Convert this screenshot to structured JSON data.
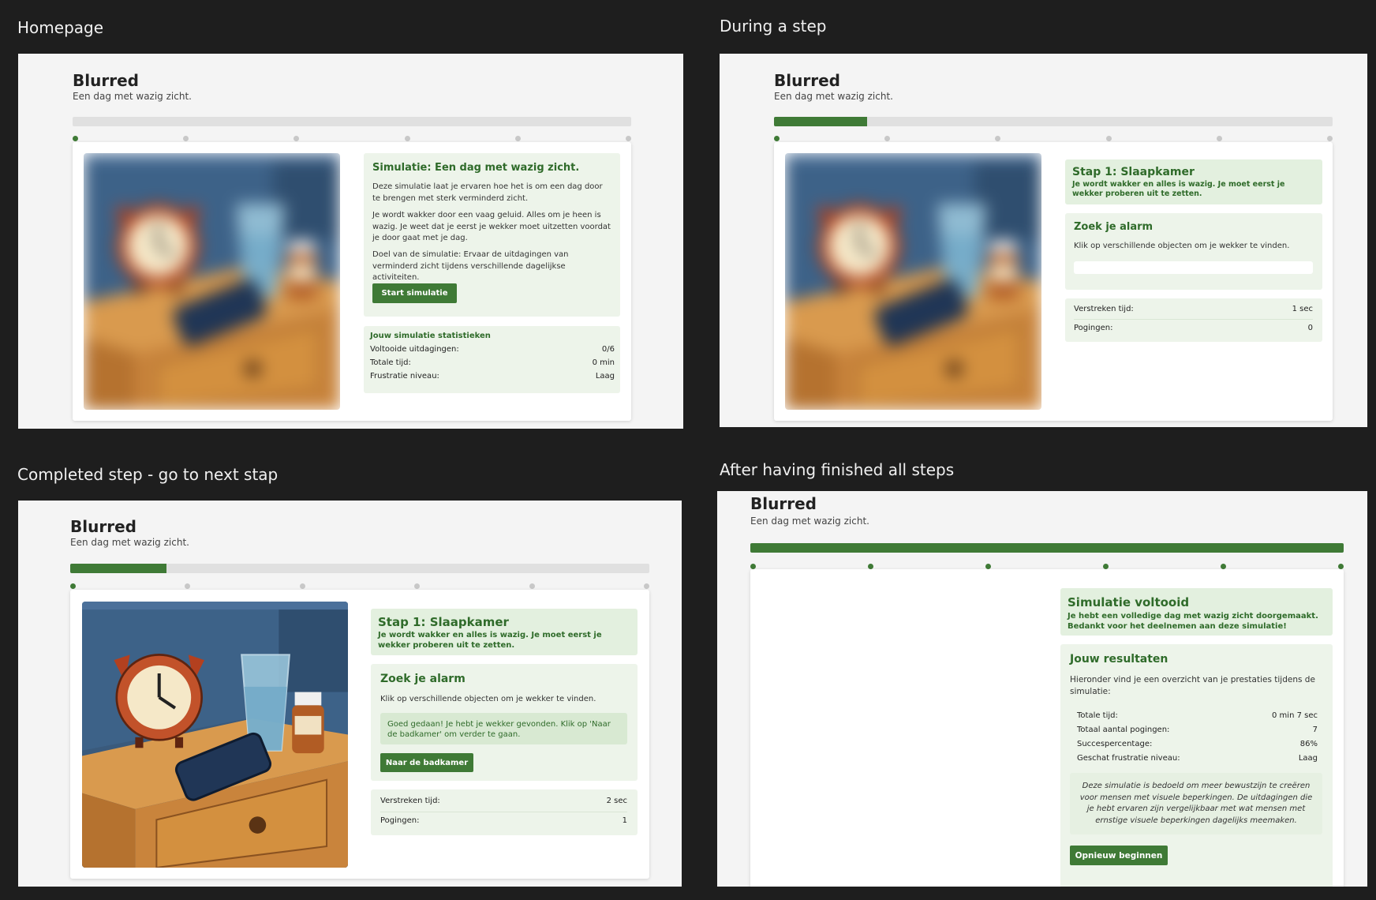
{
  "labels": {
    "homepage": "Homepage",
    "during": "During a step",
    "completed": "Completed step - go to next stap",
    "finished": "After having finished all steps"
  },
  "app": {
    "title": "Blurred",
    "subtitle": "Een dag met wazig zicht."
  },
  "colors": {
    "accent": "#3f7a36",
    "green_text": "#2f6b2a",
    "green_box": "#edf4ea",
    "track": "#e0e0e0",
    "background": "#1e1e1e"
  },
  "progress": {
    "homepage": 0,
    "during": 0.1667,
    "completed": 0.1667,
    "finished": 1
  },
  "home": {
    "intro_title": "Simulatie: Een dag met wazig zicht.",
    "intro_p1": "Deze simulatie laat je ervaren hoe het is om een dag door te brengen met sterk verminderd zicht.",
    "intro_p2": "Je wordt wakker door een vaag geluid. Alles om je heen is wazig. Je weet dat je eerst je wekker moet uitzetten voordat je door gaat met je dag.",
    "intro_p3": "Doel van de simulatie: Ervaar de uitdagingen van verminderd zicht tijdens verschillende dagelijkse activiteiten.",
    "start_button": "Start simulatie",
    "stats_title": "Jouw simulatie statistieken",
    "stats": [
      {
        "label": "Voltooide uitdagingen:",
        "value": "0/6"
      },
      {
        "label": "Totale tijd:",
        "value": "0 min"
      },
      {
        "label": "Frustratie niveau:",
        "value": "Laag"
      }
    ]
  },
  "step": {
    "title": "Stap 1: Slaapkamer",
    "desc": "Je wordt wakker en alles is wazig. Je moet eerst je wekker proberen uit te zetten.",
    "task_title": "Zoek je alarm",
    "task_desc": "Klik op verschillende objecten om je wekker te vinden.",
    "elapsed_label": "Verstreken tijd:",
    "attempts_label": "Pogingen:"
  },
  "during": {
    "elapsed": "1 sec",
    "attempts": "0"
  },
  "completed": {
    "elapsed": "2 sec",
    "attempts": "1",
    "success_msg": "Goed gedaan! Je hebt je wekker gevonden. Klik op 'Naar de badkamer' om verder te gaan.",
    "next_button": "Naar de badkamer"
  },
  "finished": {
    "title": "Simulatie voltooid",
    "desc": "Je hebt een volledige dag met wazig zicht doorgemaakt. Bedankt voor het deelnemen aan deze simulatie!",
    "results_title": "Jouw resultaten",
    "results_intro": "Hieronder vind je een overzicht van je prestaties tijdens de simulatie:",
    "results": [
      {
        "label": "Totale tijd:",
        "value": "0 min 7 sec"
      },
      {
        "label": "Totaal aantal pogingen:",
        "value": "7"
      },
      {
        "label": "Succespercentage:",
        "value": "86%"
      },
      {
        "label": "Geschat frustratie niveau:",
        "value": "Laag"
      }
    ],
    "note": "Deze simulatie is bedoeld om meer bewustzijn te creëren voor mensen met visuele beperkingen. De uitdagingen die je hebt ervaren zijn vergelijkbaar met wat mensen met ernstige visuele beperkingen dagelijks meemaken.",
    "restart_button": "Opnieuw beginnen"
  },
  "icons": {
    "scene": "bedroom-nightstand-scene-image"
  }
}
